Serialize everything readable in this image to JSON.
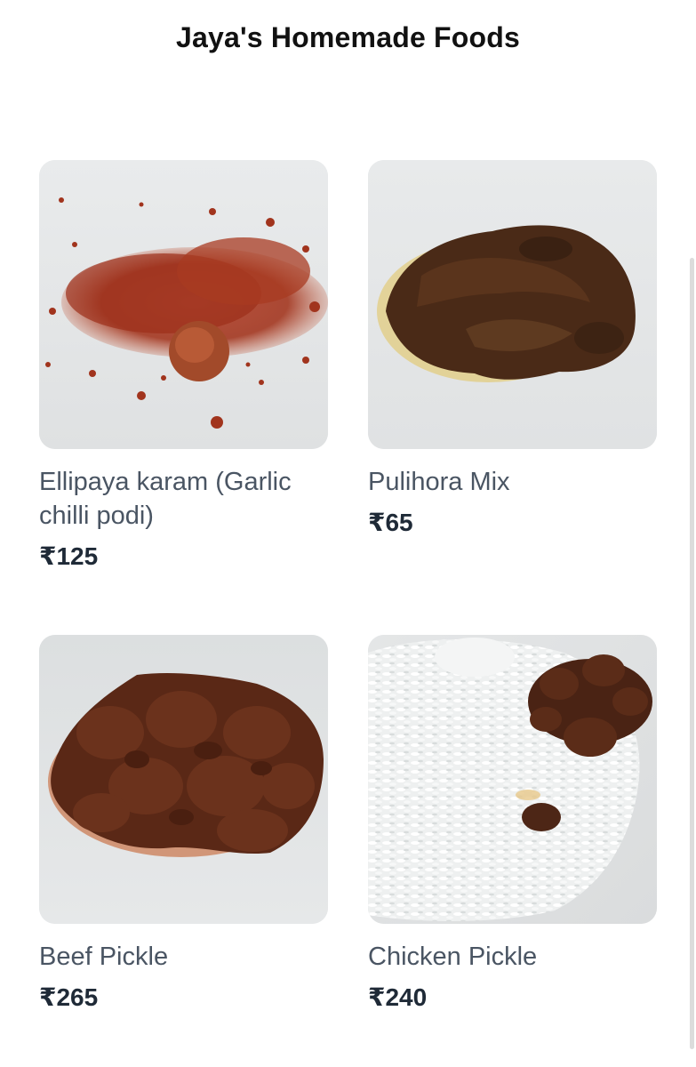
{
  "header": {
    "title": "Jaya's Homemade Foods"
  },
  "products": [
    {
      "name": "Ellipaya karam (Garlic chilli podi)",
      "price": "₹125",
      "image_icon": "garlic-chilli-podi-photo"
    },
    {
      "name": "Pulihora Mix",
      "price": "₹65",
      "image_icon": "pulihora-mix-photo"
    },
    {
      "name": "Beef Pickle",
      "price": "₹265",
      "image_icon": "beef-pickle-photo"
    },
    {
      "name": "Chicken Pickle",
      "price": "₹240",
      "image_icon": "chicken-pickle-photo"
    }
  ],
  "colors": {
    "title": "#111111",
    "product_name": "#4a5563",
    "price": "#1f2a37",
    "image_background": "#e7e9ea"
  }
}
